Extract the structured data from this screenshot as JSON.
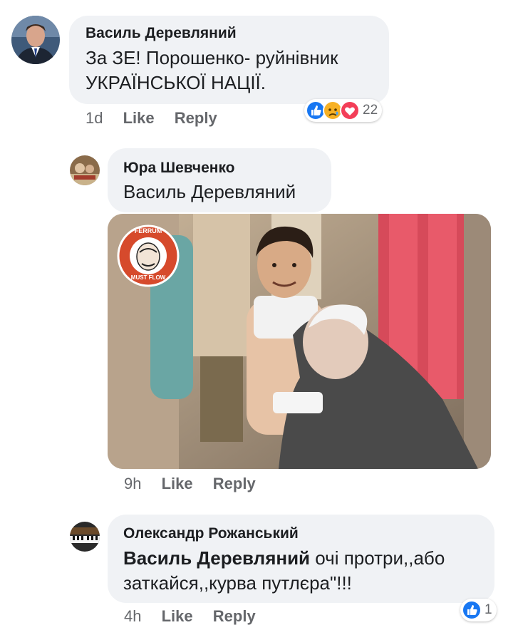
{
  "comments": [
    {
      "author": "Василь Деревляний",
      "text_line1": "За ЗЕ! Порошенко- руйнівник",
      "text_line2": "УКРАЇНСЬКОЇ НАЦІЇ.",
      "time": "1d",
      "like": "Like",
      "reply": "Reply",
      "reaction_count": "22",
      "reaction_icons": [
        "like-icon",
        "sad-icon",
        "love-icon"
      ]
    },
    {
      "author": "Юра Шевченко",
      "text": "Василь Деревляний",
      "meme_logo_top": "FERRUM",
      "meme_logo_bottom": "MUST FLOW",
      "time": "9h",
      "like": "Like",
      "reply": "Reply"
    },
    {
      "author": "Олександр Рожанський",
      "mention": "Василь Деревляний",
      "text_rest1": " очі протри,,або",
      "text_line2": "заткайся,,курва путлєра\"!!!",
      "time": "4h",
      "like": "Like",
      "reply": "Reply",
      "reaction_count": "1",
      "reaction_icons": [
        "like-icon"
      ]
    }
  ],
  "colors": {
    "bubble": "#f0f2f5",
    "meta": "#65676b",
    "like_blue": "#1877f2",
    "love_red": "#f33e58",
    "sad_yellow": "#f7b125"
  }
}
